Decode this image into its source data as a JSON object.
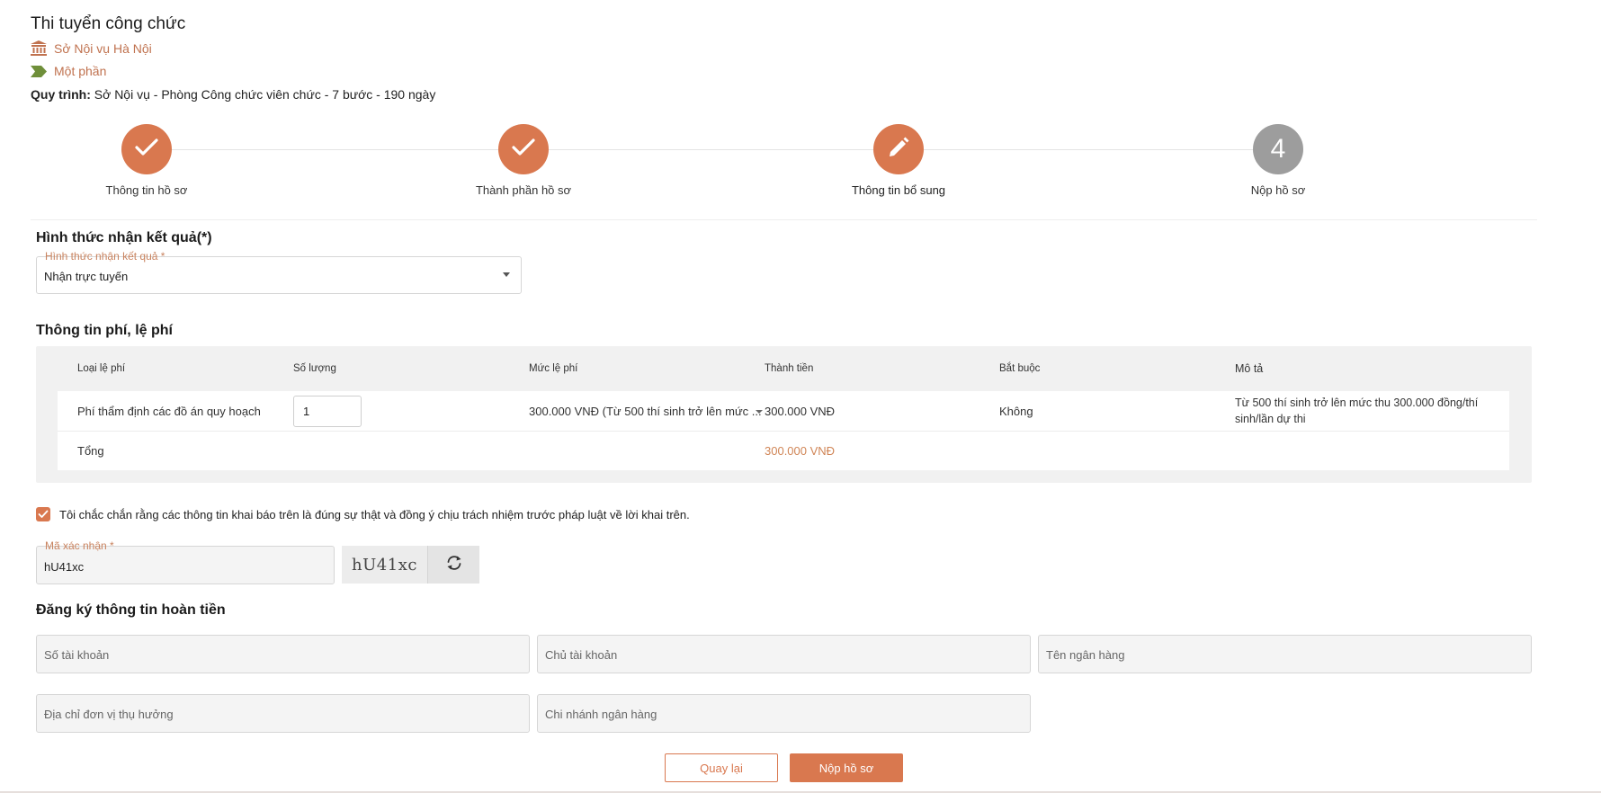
{
  "header": {
    "title": "Thi tuyển công chức",
    "agency": "Sở Nội vụ Hà Nội",
    "level": "Một phần",
    "process_label": "Quy trình:",
    "process_value": " Sở Nội vụ - Phòng Công chức viên chức - 7 bước - 190 ngày"
  },
  "stepper": {
    "steps": [
      {
        "label": "Thông tin hồ sơ",
        "state": "done"
      },
      {
        "label": "Thành phần hồ sơ",
        "state": "done"
      },
      {
        "label": "Thông tin bổ sung",
        "state": "current"
      },
      {
        "label": "Nộp hồ sơ",
        "state": "pending",
        "number": "4"
      }
    ]
  },
  "result_method": {
    "section_title": "Hình thức nhận kết quả(*)",
    "field_label": "Hình thức nhận kết quả *",
    "value": "Nhận trực tuyến"
  },
  "fees": {
    "section_title": "Thông tin phí, lệ phí",
    "columns": [
      "Loại lệ phí",
      "Số lượng",
      "Mức lệ phí",
      "Thành tiền",
      "Bắt buộc",
      "Mô tả"
    ],
    "rows": [
      {
        "type": "Phí thẩm định các đồ án quy hoạch",
        "quantity": "1",
        "rate": "300.000 VNĐ (Từ 500 thí sinh trở lên mức ...",
        "amount": "300.000 VNĐ",
        "required": "Không",
        "description": "Từ 500 thí sinh trở lên mức thu 300.000 đồng/thí sinh/lần dự thi"
      }
    ],
    "total_label": "Tổng",
    "total_amount": "300.000 VNĐ"
  },
  "confirmation": {
    "checked": true,
    "text": "Tôi chắc chắn rằng các thông tin khai báo trên là đúng sự thật và đồng ý chịu trách nhiệm trước pháp luật về lời khai trên."
  },
  "captcha": {
    "field_label": "Mã xác nhận *",
    "value": "hU41xc",
    "image_text": "hU41xc"
  },
  "refund": {
    "section_title": "Đăng ký thông tin hoàn tiền",
    "account_number_placeholder": "Số tài khoản",
    "account_holder_placeholder": "Chủ tài khoản",
    "bank_name_placeholder": "Tên ngân hàng",
    "beneficiary_address_placeholder": "Địa chỉ đơn vị thụ hưởng",
    "bank_branch_placeholder": "Chi nhánh ngân hàng"
  },
  "actions": {
    "back_label": "Quay lại",
    "submit_label": "Nộp hồ sơ"
  },
  "colors": {
    "accent": "#d9784f",
    "pending_step": "#9d9d9d",
    "label_accent": "#c9835f"
  },
  "icons": {
    "agency": "institution-icon",
    "level": "tag-arrow-icon",
    "done_step": "check-icon",
    "current_step": "pencil-icon",
    "refresh": "refresh-icon"
  }
}
